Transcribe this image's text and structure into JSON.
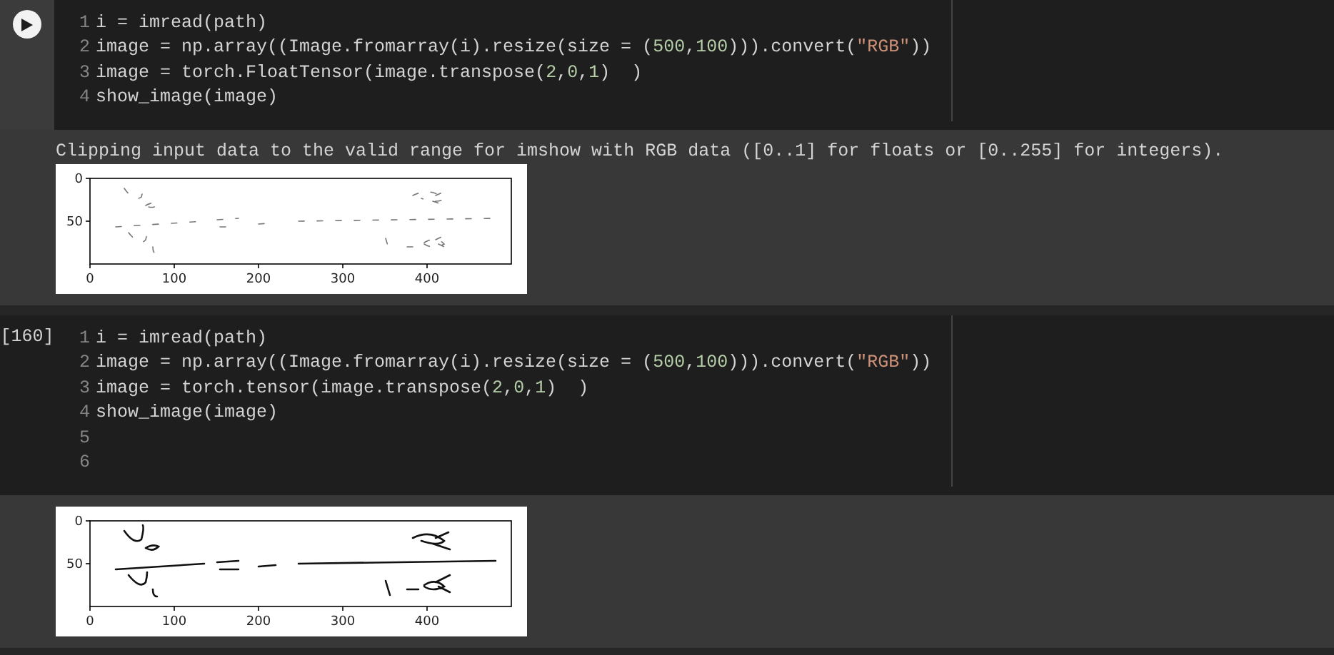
{
  "cells": [
    {
      "gutter": {
        "kind": "run_button"
      },
      "lines": [
        {
          "number": "1",
          "tokens": [
            {
              "kind": "plain",
              "text": "i = imread(path)"
            }
          ]
        },
        {
          "number": "2",
          "tokens": [
            {
              "kind": "plain",
              "text": "image = np.array((Image.fromarray(i).resize(size = ("
            },
            {
              "kind": "number",
              "text": "500"
            },
            {
              "kind": "plain",
              "text": ","
            },
            {
              "kind": "number",
              "text": "100"
            },
            {
              "kind": "plain",
              "text": "))).convert("
            },
            {
              "kind": "string",
              "text": "\"RGB\""
            },
            {
              "kind": "plain",
              "text": "))"
            }
          ]
        },
        {
          "number": "3",
          "tokens": [
            {
              "kind": "plain",
              "text": "image = torch.FloatTensor(image.transpose("
            },
            {
              "kind": "number",
              "text": "2"
            },
            {
              "kind": "plain",
              "text": ","
            },
            {
              "kind": "number",
              "text": "0"
            },
            {
              "kind": "plain",
              "text": ","
            },
            {
              "kind": "number",
              "text": "1"
            },
            {
              "kind": "plain",
              "text": ")  )"
            }
          ]
        },
        {
          "number": "4",
          "tokens": [
            {
              "kind": "plain",
              "text": "show_image(image)"
            }
          ]
        }
      ],
      "output": {
        "message": "Clipping input data to the valid range for imshow with RGB data ([0..1] for floats or [0..255] for integers).",
        "plot": {
          "clipped": true,
          "x_ticks": [
            "0",
            "100",
            "200",
            "300",
            "400"
          ],
          "y_ticks": [
            "0",
            "50"
          ]
        }
      }
    },
    {
      "gutter": {
        "kind": "prompt",
        "text": "[160]"
      },
      "lines": [
        {
          "number": "1",
          "tokens": [
            {
              "kind": "plain",
              "text": "i = imread(path)"
            }
          ]
        },
        {
          "number": "2",
          "tokens": [
            {
              "kind": "plain",
              "text": "image = np.array((Image.fromarray(i).resize(size = ("
            },
            {
              "kind": "number",
              "text": "500"
            },
            {
              "kind": "plain",
              "text": ","
            },
            {
              "kind": "number",
              "text": "100"
            },
            {
              "kind": "plain",
              "text": "))).convert("
            },
            {
              "kind": "string",
              "text": "\"RGB\""
            },
            {
              "kind": "plain",
              "text": "))"
            }
          ]
        },
        {
          "number": "3",
          "tokens": [
            {
              "kind": "plain",
              "text": "image = torch.tensor(image.transpose("
            },
            {
              "kind": "number",
              "text": "2"
            },
            {
              "kind": "plain",
              "text": ","
            },
            {
              "kind": "number",
              "text": "0"
            },
            {
              "kind": "plain",
              "text": ","
            },
            {
              "kind": "number",
              "text": "1"
            },
            {
              "kind": "plain",
              "text": ")  )"
            }
          ]
        },
        {
          "number": "4",
          "tokens": [
            {
              "kind": "plain",
              "text": "show_image(image)"
            }
          ]
        },
        {
          "number": "5"
        },
        {
          "number": "6"
        }
      ],
      "output": {
        "plot": {
          "clipped": false,
          "x_ticks": [
            "0",
            "100",
            "200",
            "300",
            "400"
          ],
          "y_ticks": [
            "0",
            "50"
          ]
        }
      }
    }
  ]
}
